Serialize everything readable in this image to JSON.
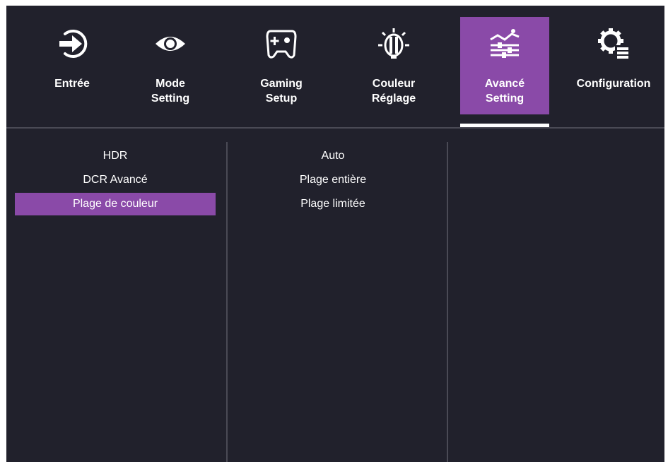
{
  "colors": {
    "background": "#21212c",
    "accent": "#8a4aa8",
    "text": "#ffffff",
    "divider": "#4a4a55"
  },
  "tabs": [
    {
      "label": "Entrée",
      "icon": "input-icon",
      "active": false
    },
    {
      "label": "Mode\nSetting",
      "icon": "eye-icon",
      "active": false
    },
    {
      "label": "Gaming\nSetup",
      "icon": "gamepad-icon",
      "active": false
    },
    {
      "label": "Couleur\nRéglage",
      "icon": "color-bulb-icon",
      "active": false
    },
    {
      "label": "Avancé\nSetting",
      "icon": "advanced-settings-icon",
      "active": true
    },
    {
      "label": "Configuration",
      "icon": "gear-list-icon",
      "active": false
    }
  ],
  "menu": {
    "items": [
      "HDR",
      "DCR Avancé",
      "Plage de couleur"
    ],
    "selected": "Plage de couleur"
  },
  "submenu": {
    "items": [
      "Auto",
      "Plage entière",
      "Plage limitée"
    ]
  }
}
